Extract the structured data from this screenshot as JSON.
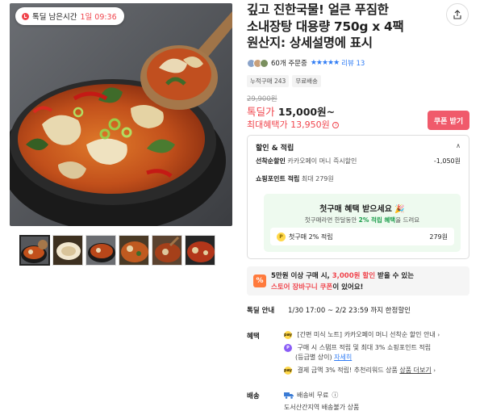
{
  "deal_timer": {
    "label": "톡딜 남은시간",
    "time": "1일 09:36"
  },
  "product": {
    "title_lines": [
      "깊고 진한국물! 얼큰 푸짐한",
      "소내장탕 대용량 750g x 4팩",
      "원산지: 상세설명에 표시"
    ]
  },
  "reviews": {
    "orders": "60개 주문중",
    "stars": "★★★★★",
    "review_link": "리뷰 13"
  },
  "tags": [
    "누적구매 243",
    "무료배송"
  ],
  "price": {
    "original": "29,900원",
    "deal_label": "톡딜가",
    "deal_value": "15,000원~",
    "max_label": "최대혜택가",
    "max_value": "13,950원",
    "info_icon": "ⓘ"
  },
  "coupon_button": "쿠폰 받기",
  "discount": {
    "header": "할인 & 적립",
    "chevron": "∧",
    "first_key": "선착순할인",
    "first_desc": "카카오페이 머니 즉시할인",
    "first_amount": "-1,050원",
    "points_key": "쇼핑포인트 적립",
    "points_max": "최대 279원",
    "first_buy_title": "첫구매 혜택 받으세요 🎉",
    "first_buy_sub_pre": "첫구매라면 한달동안 ",
    "first_buy_sub_hl": "2% 적립 혜택",
    "first_buy_sub_post": "을 드려요",
    "coin_letter": "P",
    "first_buy_item": "첫구매 2% 적립",
    "first_buy_amount": "279원"
  },
  "cart_banner": {
    "icon": "%",
    "line1_pre": "5만원 이상 구매 시, ",
    "line1_red": "3,000원 할인",
    "line1_post": " 받을 수 있는",
    "line2_red": "스토어 장바구니 쿠폰",
    "line2_post": "이 있어요!"
  },
  "deal_info": {
    "label": "톡딜 안내",
    "value": "1/30 17:00 ~ 2/2 23:59 까지 한정할인"
  },
  "benefits": {
    "label": "혜택",
    "items": [
      {
        "icon": "pay",
        "text": "[간편 미식 노트] 카카오페이 머니 선착순 할인 안내",
        "extra": ""
      },
      {
        "icon": "P",
        "text": "구매 시 스탬프 적립 및 최대 3% 쇼핑포인트 적립",
        "text2": "(등급별 상이)",
        "link": "자세히"
      },
      {
        "icon": "pay",
        "text": "결제 금액 3% 적립! 추천리워드 상품",
        "link": "상품 더보기"
      }
    ],
    "chevron": "›"
  },
  "shipping": {
    "label": "배송",
    "line1": "배송비 무료",
    "line2": "도서산간지역 배송불가 상품",
    "chevron": "ⓘ"
  },
  "colors": {
    "accent_red": "#f0454d",
    "link_blue": "#2f7cf5",
    "green": "#1a9c4a",
    "coupon_btn": "#f05a6b"
  }
}
